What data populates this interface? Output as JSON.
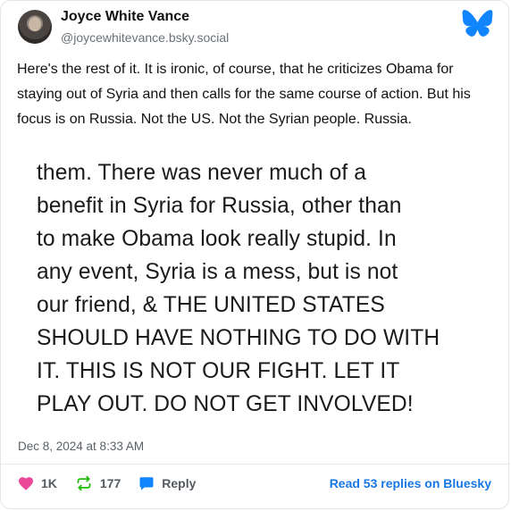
{
  "author": {
    "name": "Joyce White Vance",
    "handle": "@joycewhitevance.bsky.social"
  },
  "post": {
    "text": "Here's the rest of it. It is ironic, of course, that he criticizes Obama for staying out of Syria and then calls for the same course of action. But his focus is on Russia. Not the US. Not the Syrian people. Russia.",
    "quoted_image_lines": [
      "them. There was never much of a",
      "benefit in Syria for Russia, other than",
      "to make Obama look really stupid. In",
      "any event, Syria is a mess, but is not",
      "our friend, & THE UNITED STATES",
      "SHOULD HAVE NOTHING TO DO WITH",
      "IT. THIS IS NOT OUR FIGHT. LET IT",
      "PLAY OUT. DO NOT GET INVOLVED!"
    ],
    "timestamp": "Dec 8, 2024 at 8:33 AM"
  },
  "actions": {
    "likes": "1K",
    "reposts": "177",
    "reply_label": "Reply",
    "read_more": "Read 53 replies on Bluesky"
  },
  "icons": {
    "like": "heart-icon",
    "repost": "repost-icon",
    "reply": "reply-bubble-icon",
    "brand": "bluesky-butterfly-icon"
  },
  "colors": {
    "brand": "#1185fe",
    "like": "#ec4899",
    "repost": "#20bc07",
    "reply": "#1185fe",
    "link": "#1877e6"
  }
}
